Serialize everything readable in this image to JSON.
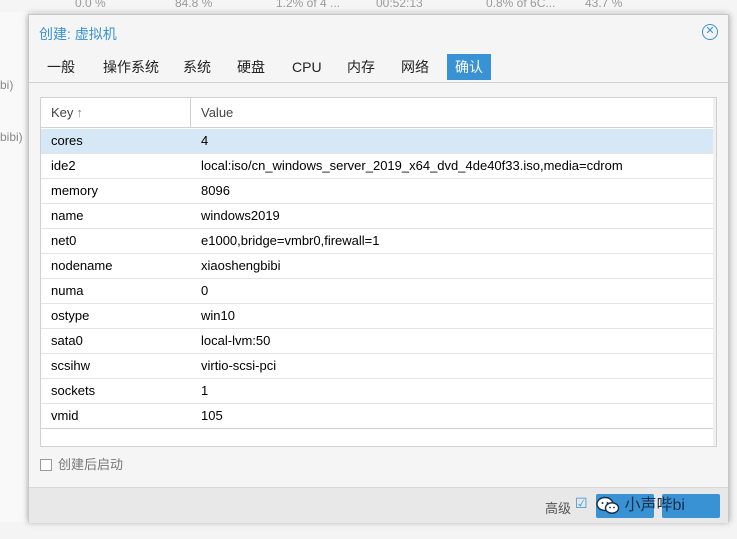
{
  "background": {
    "top_stats": [
      "0.0 %",
      "84.8 %",
      "1.2% of 4 ...",
      "00:52:13",
      "0.8% of 6C...",
      "43.7 %"
    ],
    "left_items": [
      "bi)",
      "bibi)"
    ]
  },
  "dialog": {
    "title": "创建: 虚拟机",
    "close_icon": "close-circle-icon",
    "tabs": [
      {
        "label": "一般",
        "active": false
      },
      {
        "label": "操作系统",
        "active": false
      },
      {
        "label": "系统",
        "active": false
      },
      {
        "label": "硬盘",
        "active": false
      },
      {
        "label": "CPU",
        "active": false
      },
      {
        "label": "内存",
        "active": false
      },
      {
        "label": "网络",
        "active": false
      },
      {
        "label": "确认",
        "active": true
      }
    ],
    "grid": {
      "columns": {
        "key": "Key",
        "value": "Value"
      },
      "sort_icon": "sort-ascending-arrow-icon",
      "rows": [
        {
          "key": "cores",
          "value": "4",
          "selected": true
        },
        {
          "key": "ide2",
          "value": "local:iso/cn_windows_server_2019_x64_dvd_4de40f33.iso,media=cdrom"
        },
        {
          "key": "memory",
          "value": "8096"
        },
        {
          "key": "name",
          "value": "windows2019"
        },
        {
          "key": "net0",
          "value": "e1000,bridge=vmbr0,firewall=1"
        },
        {
          "key": "nodename",
          "value": "xiaoshengbibi"
        },
        {
          "key": "numa",
          "value": "0"
        },
        {
          "key": "ostype",
          "value": "win10"
        },
        {
          "key": "sata0",
          "value": "local-lvm:50"
        },
        {
          "key": "scsihw",
          "value": "virtio-scsi-pci"
        },
        {
          "key": "sockets",
          "value": "1"
        },
        {
          "key": "vmid",
          "value": "105"
        }
      ]
    },
    "start_after_create": {
      "label": "创建后启动",
      "checked": false
    },
    "footer": {
      "advanced_label": "高级",
      "advanced_checked": true
    }
  },
  "watermark": {
    "text": "小声哔bi",
    "icon": "wechat-icon"
  },
  "colors": {
    "accent": "#3892d4",
    "selected_row": "#d6e7f6"
  }
}
